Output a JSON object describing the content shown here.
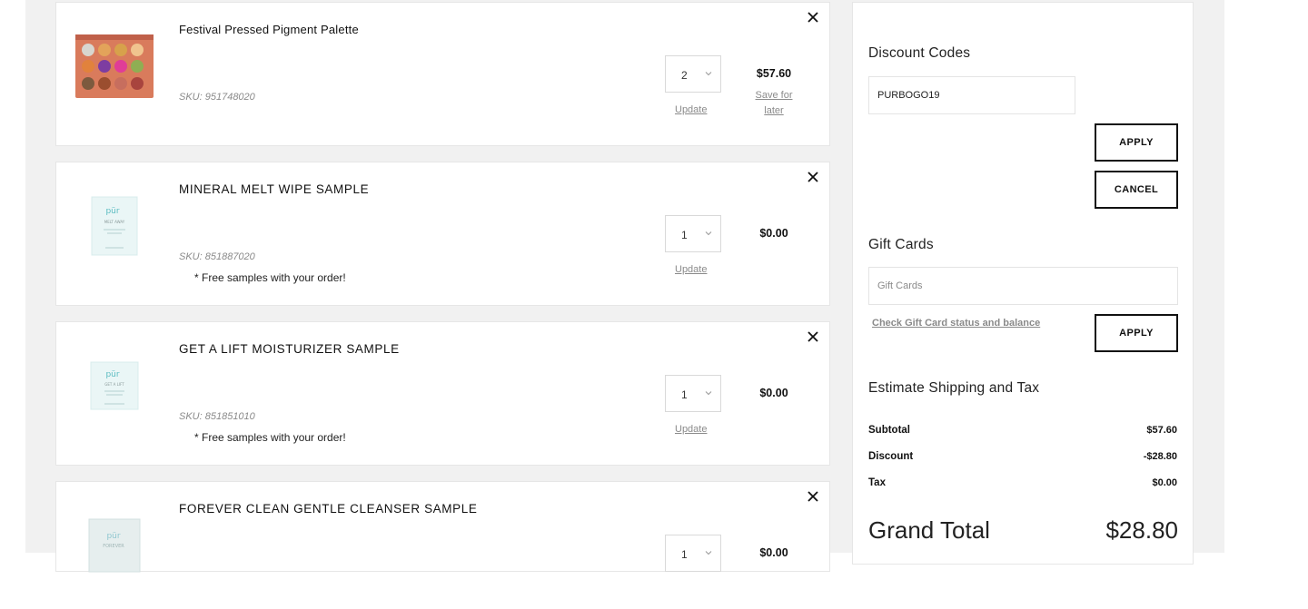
{
  "cart": {
    "items": [
      {
        "name": "Festival Pressed Pigment Palette",
        "sku": "SKU: 951748020",
        "qty": "2",
        "price": "$57.60",
        "update_label": "Update",
        "save_later_label": "Save for later",
        "note": ""
      },
      {
        "name": "MINERAL MELT WIPE SAMPLE",
        "sku": "SKU: 851887020",
        "qty": "1",
        "price": "$0.00",
        "update_label": "Update",
        "note": "* Free samples with your order!"
      },
      {
        "name": "GET A LIFT MOISTURIZER SAMPLE",
        "sku": "SKU: 851851010",
        "qty": "1",
        "price": "$0.00",
        "update_label": "Update",
        "note": "* Free samples with your order!"
      },
      {
        "name": "FOREVER CLEAN GENTLE CLEANSER SAMPLE",
        "qty": "1",
        "price": "$0.00"
      }
    ],
    "sample_brand": "pür",
    "sample_labels": [
      "MELT AWAY",
      "GET A LIFT",
      "FOREVER"
    ]
  },
  "summary": {
    "discount_title": "Discount Codes",
    "discount_value": "PURBOGO19",
    "apply_label": "APPLY",
    "cancel_label": "CANCEL",
    "gift_title": "Gift Cards",
    "gift_placeholder": "Gift Cards",
    "gift_link": "Check Gift Card status and balance",
    "gift_apply_label": "APPLY",
    "shipping_title": "Estimate Shipping and Tax",
    "subtotal_label": "Subtotal",
    "subtotal_value": "$57.60",
    "discount_label": "Discount",
    "discount_amount": "-$28.80",
    "tax_label": "Tax",
    "tax_value": "$0.00",
    "grand_label": "Grand Total",
    "grand_value": "$28.80"
  },
  "colors": {
    "page_bg": "#f1f1f1",
    "card_bg": "#ffffff",
    "muted_text": "#8a8a8a",
    "button_border": "#111111",
    "sample_accent": "#7fcfd2"
  }
}
